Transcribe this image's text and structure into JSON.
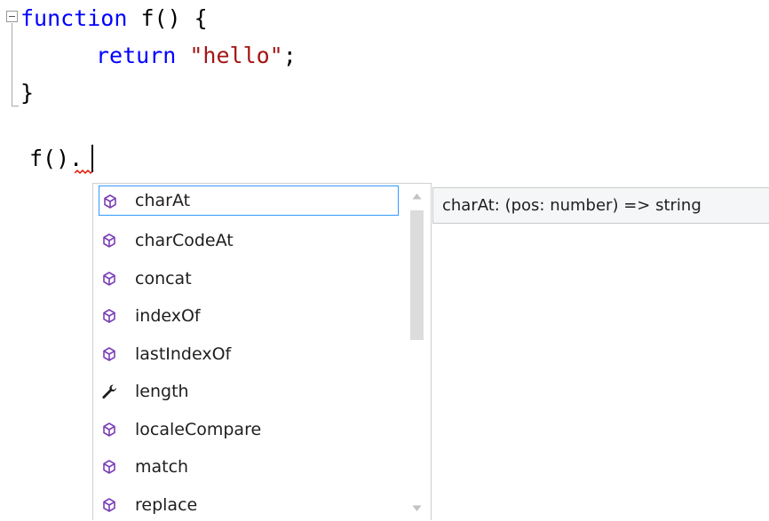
{
  "editor": {
    "lines": [
      {
        "keyword": "function",
        "rest": " f() {"
      },
      {
        "keyword": "return",
        "string": "\"hello\"",
        "end": ";"
      },
      {
        "text": "}"
      },
      {
        "text": "f()."
      }
    ]
  },
  "completion": {
    "items": [
      {
        "label": "charAt",
        "icon": "method-icon",
        "selected": true
      },
      {
        "label": "charCodeAt",
        "icon": "method-icon"
      },
      {
        "label": "concat",
        "icon": "method-icon"
      },
      {
        "label": "indexOf",
        "icon": "method-icon"
      },
      {
        "label": "lastIndexOf",
        "icon": "method-icon"
      },
      {
        "label": "length",
        "icon": "property-wrench-icon"
      },
      {
        "label": "localeCompare",
        "icon": "method-icon"
      },
      {
        "label": "match",
        "icon": "method-icon"
      },
      {
        "label": "replace",
        "icon": "method-icon"
      }
    ],
    "tooltip": "charAt: (pos: number) => string"
  },
  "colors": {
    "keyword": "#0000ff",
    "string": "#a31515",
    "method_icon": "#7b3fb6",
    "selection_border": "#3399ff"
  }
}
